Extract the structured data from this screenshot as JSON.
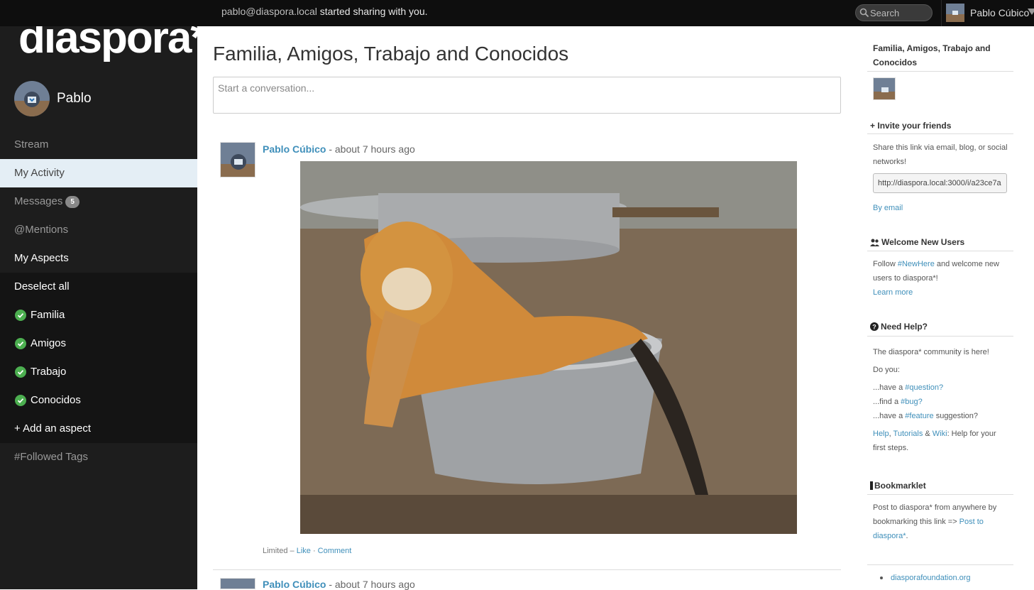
{
  "topbar": {
    "notification_email": "pablo@diaspora.local",
    "notification_text": "started sharing with you.",
    "search_placeholder": "Search",
    "user_name": "Pablo Cúbico"
  },
  "sidebar": {
    "logo": "diaspora*",
    "user_name": "Pablo",
    "stream": "Stream",
    "my_activity": "My Activity",
    "messages": "Messages",
    "messages_count": "5",
    "mentions": "@Mentions",
    "my_aspects": "My Aspects",
    "deselect_all": "Deselect all",
    "aspects": [
      "Familia",
      "Amigos",
      "Trabajo",
      "Conocidos"
    ],
    "add_aspect": "+ Add an aspect",
    "followed_tags": "#Followed Tags"
  },
  "main": {
    "title": "Familia, Amigos, Trabajo and Conocidos",
    "publisher_placeholder": "Start a conversation...",
    "posts": [
      {
        "author": "Pablo Cúbico",
        "time": "- about 7 hours ago",
        "visibility": "Limited",
        "sep": " – ",
        "like": "Like",
        "dot": " · ",
        "comment": "Comment"
      },
      {
        "author": "Pablo Cúbico",
        "time": "- about 7 hours ago"
      }
    ]
  },
  "right": {
    "aspect_title": "Familia, Amigos, Trabajo and Conocidos",
    "invite_title": "Invite your friends",
    "invite_plus": "+",
    "invite_text": "Share this link via email, blog, or social networks!",
    "invite_url": "http://diaspora.local:3000/i/a23ce7a",
    "by_email": "By email",
    "welcome_title": "Welcome New Users",
    "welcome_pre": "Follow ",
    "welcome_tag": "#NewHere",
    "welcome_post": " and welcome new users to diaspora*!",
    "learn_more": "Learn more",
    "help_title": "Need Help?",
    "help_intro": "The diaspora* community is here!",
    "help_do_you": "Do you:",
    "help_q_pre": "...have a ",
    "help_q_tag": "#question?",
    "help_b_pre": "...find a ",
    "help_b_tag": "#bug?",
    "help_f_pre": "...have a ",
    "help_f_tag": "#feature",
    "help_f_post": " suggestion?",
    "help_links_1": "Help",
    "help_links_2": "Tutorials",
    "help_links_amp": " & ",
    "help_links_3": "Wiki",
    "help_links_post": ": Help for your first steps.",
    "bookmarklet_title": "Bookmarklet",
    "bookmarklet_text": "Post to diaspora* from anywhere by bookmarking this link => ",
    "bookmarklet_link": "Post to diaspora*",
    "bookmarklet_end": ".",
    "footer_link": "diasporafoundation.org"
  },
  "colors": {
    "accent": "#3f8fba",
    "sidebar_bg": "#1d1d1d",
    "active_bg": "#e4eef5",
    "check": "#4caf50"
  }
}
